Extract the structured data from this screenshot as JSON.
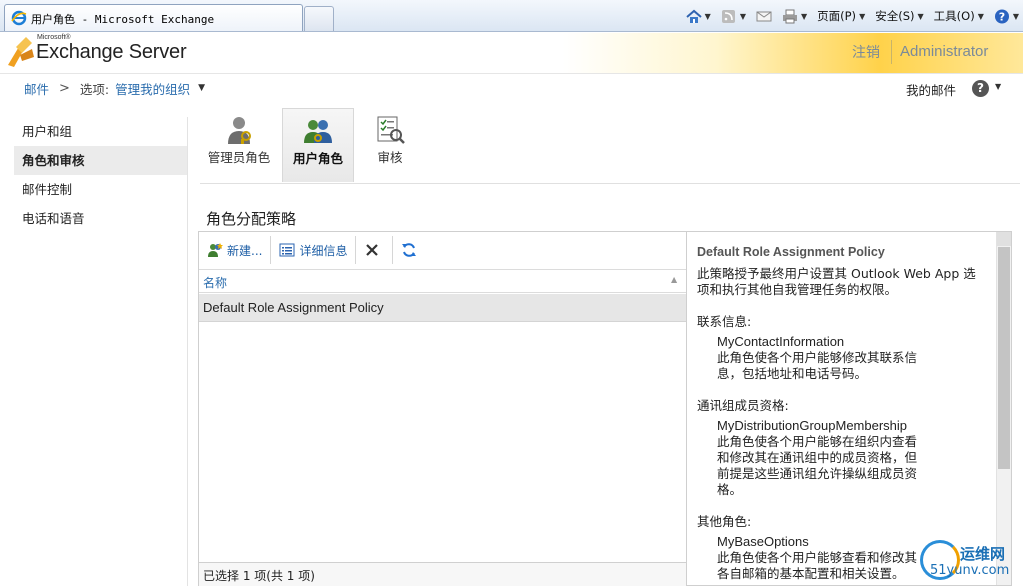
{
  "browser": {
    "tab_title": "用户角色 - Microsoft Exchange",
    "commands": [
      {
        "name": "home-icon"
      },
      {
        "name": "feeds-icon"
      },
      {
        "name": "mail-icon"
      },
      {
        "name": "print-icon"
      },
      {
        "label": "页面(P)"
      },
      {
        "label": "安全(S)"
      },
      {
        "label": "工具(O)"
      },
      {
        "name": "help-icon"
      }
    ]
  },
  "header": {
    "logo_microsoft": "Microsoft®",
    "logo_product": "Exchange Server",
    "signout": "注销",
    "user": "Administrator"
  },
  "breadcrumb": {
    "root": "邮件",
    "separator": ">",
    "options_label": "选项:",
    "current": "管理我的组织"
  },
  "top_right": {
    "my_mail": "我的邮件",
    "help": "?"
  },
  "left_nav": {
    "items": [
      {
        "label": "用户和组"
      },
      {
        "label": "角色和审核"
      },
      {
        "label": "邮件控制"
      },
      {
        "label": "电话和语音"
      }
    ]
  },
  "role_tabs": [
    {
      "label": "管理员角色"
    },
    {
      "label": "用户角色"
    },
    {
      "label": "审核"
    }
  ],
  "section_title": "角色分配策略",
  "toolbar": {
    "new_label": "新建...",
    "details_label": "详细信息"
  },
  "table": {
    "column_name": "名称",
    "rows": [
      "Default Role Assignment Policy"
    ],
    "status": "已选择 1 项(共 1 项)"
  },
  "details": {
    "title": "Default Role Assignment Policy",
    "description": "此策略授予最终用户设置其 Outlook Web App 选项和执行其他自我管理任务的权限。",
    "groups": [
      {
        "label": "联系信息:",
        "role": "MyContactInformation",
        "role_desc": "此角色使各个用户能够修改其联系信息，包括地址和电话号码。"
      },
      {
        "label": "通讯组成员资格:",
        "role": "MyDistributionGroupMembership",
        "role_desc": "此角色使各个用户能够在组织内查看和修改其在通讯组中的成员资格，但前提是这些通讯组允许操纵组成员资格。"
      },
      {
        "label": "其他角色:",
        "role": "MyBaseOptions",
        "role_desc": "此角色使各个用户能够查看和修改其各自邮箱的基本配置和相关设置。"
      }
    ]
  },
  "watermark": {
    "line1": "运维网",
    "line2": "51yunv.com"
  },
  "colors": {
    "link": "#2a6cad",
    "header_gold": "#ffd24a",
    "selected_row": "#e6e6e6"
  }
}
